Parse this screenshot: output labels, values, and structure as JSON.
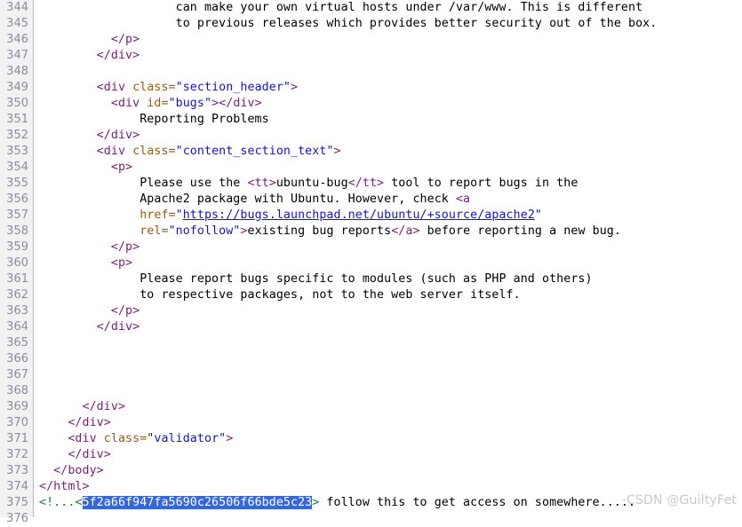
{
  "editor": {
    "first_line_number": 344,
    "line_count": 33,
    "gutter_bg": "#f2f2f2",
    "gutter_fg": "#8c8ca0",
    "selection_bg": "#3767d6",
    "selection_fg": "#ffffff",
    "tag_color": "#7c1c7c",
    "attr_color": "#9a5a12",
    "value_color": "#1414cc",
    "text_color": "#000000",
    "comment_color": "#1d7a2e",
    "background": "#ffffff"
  },
  "line_numbers": [
    "344",
    "345",
    "346",
    "347",
    "348",
    "349",
    "350",
    "351",
    "352",
    "353",
    "354",
    "355",
    "356",
    "357",
    "358",
    "359",
    "360",
    "361",
    "362",
    "363",
    "364",
    "365",
    "366",
    "367",
    "368",
    "369",
    "370",
    "371",
    "372",
    "373",
    "374",
    "375",
    "376"
  ],
  "lines": [
    {
      "n": "344",
      "tokens": [
        {
          "t": "txt",
          "v": "                   can make your own virtual hosts under /var/www. This is different"
        }
      ]
    },
    {
      "n": "345",
      "tokens": [
        {
          "t": "txt",
          "v": "                   to previous releases which provides better security out of the box."
        }
      ]
    },
    {
      "n": "346",
      "tokens": [
        {
          "t": "tag",
          "v": "          </p>"
        }
      ]
    },
    {
      "n": "347",
      "tokens": [
        {
          "t": "tag",
          "v": "        </div>"
        }
      ]
    },
    {
      "n": "348",
      "tokens": []
    },
    {
      "n": "349",
      "tokens": [
        {
          "t": "tag",
          "v": "        <div "
        },
        {
          "t": "attr",
          "v": "class="
        },
        {
          "t": "val",
          "v": "\"section_header\""
        },
        {
          "t": "tag",
          "v": ">"
        }
      ]
    },
    {
      "n": "350",
      "tokens": [
        {
          "t": "tag",
          "v": "          <div "
        },
        {
          "t": "attr",
          "v": "id="
        },
        {
          "t": "val",
          "v": "\"bugs\""
        },
        {
          "t": "tag",
          "v": "></div>"
        }
      ]
    },
    {
      "n": "351",
      "tokens": [
        {
          "t": "txt",
          "v": "              Reporting Problems"
        }
      ]
    },
    {
      "n": "352",
      "tokens": [
        {
          "t": "tag",
          "v": "        </div>"
        }
      ]
    },
    {
      "n": "353",
      "tokens": [
        {
          "t": "tag",
          "v": "        <div "
        },
        {
          "t": "attr",
          "v": "class="
        },
        {
          "t": "val",
          "v": "\"content_section_text\""
        },
        {
          "t": "tag",
          "v": ">"
        }
      ]
    },
    {
      "n": "354",
      "tokens": [
        {
          "t": "tag",
          "v": "          <p>"
        }
      ]
    },
    {
      "n": "355",
      "tokens": [
        {
          "t": "txt",
          "v": "              Please use the "
        },
        {
          "t": "tag",
          "v": "<tt>"
        },
        {
          "t": "txt",
          "v": "ubuntu-bug"
        },
        {
          "t": "tag",
          "v": "</tt>"
        },
        {
          "t": "txt",
          "v": " tool to report bugs in the"
        }
      ]
    },
    {
      "n": "356",
      "tokens": [
        {
          "t": "txt",
          "v": "              Apache2 package with Ubuntu. However, check "
        },
        {
          "t": "tag",
          "v": "<a"
        }
      ]
    },
    {
      "n": "357",
      "tokens": [
        {
          "t": "attr",
          "v": "              href="
        },
        {
          "t": "val",
          "v": "\""
        },
        {
          "t": "link",
          "v": "https://bugs.launchpad.net/ubuntu/+source/apache2"
        },
        {
          "t": "val",
          "v": "\""
        }
      ]
    },
    {
      "n": "358",
      "tokens": [
        {
          "t": "attr",
          "v": "              rel="
        },
        {
          "t": "val",
          "v": "\"nofollow\""
        },
        {
          "t": "tag",
          "v": ">"
        },
        {
          "t": "txt",
          "v": "existing bug reports"
        },
        {
          "t": "tag",
          "v": "</a>"
        },
        {
          "t": "txt",
          "v": " before reporting a new bug."
        }
      ]
    },
    {
      "n": "359",
      "tokens": [
        {
          "t": "tag",
          "v": "          </p>"
        }
      ]
    },
    {
      "n": "360",
      "tokens": [
        {
          "t": "tag",
          "v": "          <p>"
        }
      ]
    },
    {
      "n": "361",
      "tokens": [
        {
          "t": "txt",
          "v": "              Please report bugs specific to modules (such as PHP and others)"
        }
      ]
    },
    {
      "n": "362",
      "tokens": [
        {
          "t": "txt",
          "v": "              to respective packages, not to the web server itself."
        }
      ]
    },
    {
      "n": "363",
      "tokens": [
        {
          "t": "tag",
          "v": "          </p>"
        }
      ]
    },
    {
      "n": "364",
      "tokens": [
        {
          "t": "tag",
          "v": "        </div>"
        }
      ]
    },
    {
      "n": "365",
      "tokens": []
    },
    {
      "n": "366",
      "tokens": []
    },
    {
      "n": "367",
      "tokens": []
    },
    {
      "n": "368",
      "tokens": []
    },
    {
      "n": "369",
      "tokens": [
        {
          "t": "tag",
          "v": "      </div>"
        }
      ]
    },
    {
      "n": "370",
      "tokens": [
        {
          "t": "tag",
          "v": "    </div>"
        }
      ]
    },
    {
      "n": "371",
      "tokens": [
        {
          "t": "tag",
          "v": "    <div "
        },
        {
          "t": "attr",
          "v": "class="
        },
        {
          "t": "val",
          "v": "\"validator\""
        },
        {
          "t": "tag",
          "v": ">"
        }
      ]
    },
    {
      "n": "372",
      "tokens": [
        {
          "t": "tag",
          "v": "    </div>"
        }
      ]
    },
    {
      "n": "373",
      "tokens": [
        {
          "t": "tag",
          "v": "  </body>"
        }
      ]
    },
    {
      "n": "374",
      "tokens": [
        {
          "t": "tag",
          "v": "</html>"
        }
      ]
    },
    {
      "n": "375",
      "tokens": [
        {
          "t": "comment",
          "v": "<!...<"
        },
        {
          "t": "sel",
          "v": "5f2a66f947fa5690c26506f66bde5c23"
        },
        {
          "t": "comment",
          "v": ">"
        },
        {
          "t": "txt",
          "v": " follow this to get access on somewhere....."
        }
      ]
    },
    {
      "n": "376",
      "tokens": []
    }
  ],
  "watermark": {
    "text": "-CSDN @GuiltyFet",
    "color": "#c9c9c9"
  }
}
